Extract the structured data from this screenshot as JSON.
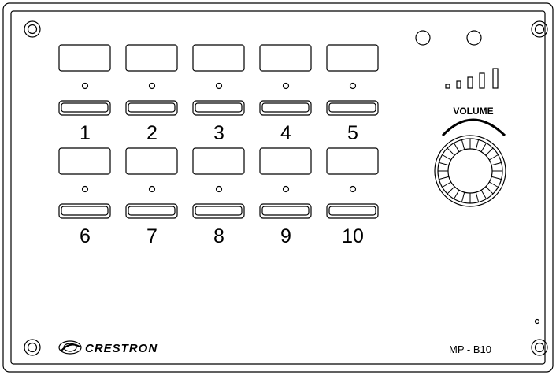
{
  "panel": {
    "volume_label": "VOLUME",
    "model_label": "MP - B10",
    "brand_label": "CRESTRON"
  },
  "buttons": [
    {
      "label": "1"
    },
    {
      "label": "2"
    },
    {
      "label": "3"
    },
    {
      "label": "4"
    },
    {
      "label": "5"
    },
    {
      "label": "6"
    },
    {
      "label": "7"
    },
    {
      "label": "8"
    },
    {
      "label": "9"
    },
    {
      "label": "10"
    }
  ],
  "colors": {
    "line": "#000000",
    "background": "#ffffff"
  },
  "icons": {
    "screw": "screw-icon",
    "brand_logo": "crestron-swirl-icon",
    "volume_meter": "volume-bars-icon",
    "volume_knob": "volume-knob-icon"
  }
}
